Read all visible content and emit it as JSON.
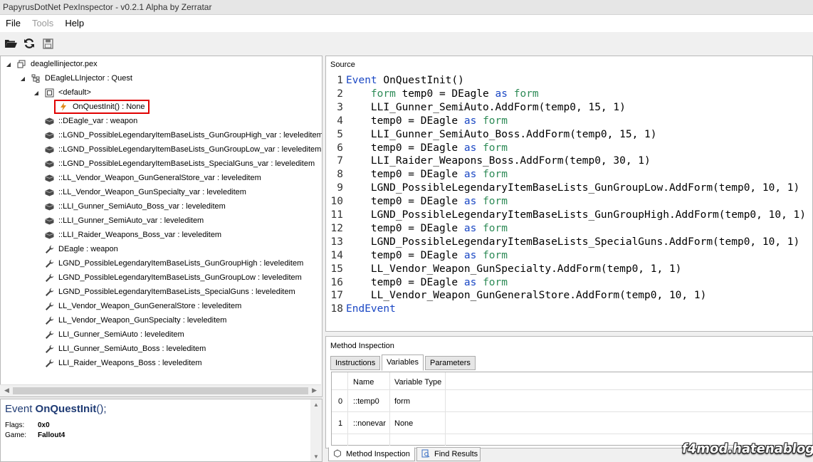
{
  "window": {
    "title": "PapyrusDotNet PexInspector - v0.2.1 Alpha by Zerratar"
  },
  "menu": {
    "file": "File",
    "tools": "Tools",
    "help": "Help"
  },
  "tree": {
    "root": "deaglellinjector.pex",
    "class": "DEagleLLInjector : Quest",
    "state": "<default>",
    "items": [
      {
        "label": "OnQuestInit() : None",
        "icon": "lightning-icon",
        "selected": true
      },
      {
        "label": "::DEagle_var : weapon",
        "icon": "field-icon"
      },
      {
        "label": "::LGND_PossibleLegendaryItemBaseLists_GunGroupHigh_var : leveleditem",
        "icon": "field-icon"
      },
      {
        "label": "::LGND_PossibleLegendaryItemBaseLists_GunGroupLow_var : leveleditem",
        "icon": "field-icon"
      },
      {
        "label": "::LGND_PossibleLegendaryItemBaseLists_SpecialGuns_var : leveleditem",
        "icon": "field-icon"
      },
      {
        "label": "::LL_Vendor_Weapon_GunGeneralStore_var : leveleditem",
        "icon": "field-icon"
      },
      {
        "label": "::LL_Vendor_Weapon_GunSpecialty_var : leveleditem",
        "icon": "field-icon"
      },
      {
        "label": "::LLI_Gunner_SemiAuto_Boss_var : leveleditem",
        "icon": "field-icon"
      },
      {
        "label": "::LLI_Gunner_SemiAuto_var : leveleditem",
        "icon": "field-icon"
      },
      {
        "label": "::LLI_Raider_Weapons_Boss_var : leveleditem",
        "icon": "field-icon"
      },
      {
        "label": "DEagle : weapon",
        "icon": "wrench-icon"
      },
      {
        "label": "LGND_PossibleLegendaryItemBaseLists_GunGroupHigh : leveleditem",
        "icon": "wrench-icon"
      },
      {
        "label": "LGND_PossibleLegendaryItemBaseLists_GunGroupLow : leveleditem",
        "icon": "wrench-icon"
      },
      {
        "label": "LGND_PossibleLegendaryItemBaseLists_SpecialGuns : leveleditem",
        "icon": "wrench-icon"
      },
      {
        "label": "LL_Vendor_Weapon_GunGeneralStore : leveleditem",
        "icon": "wrench-icon"
      },
      {
        "label": "LL_Vendor_Weapon_GunSpecialty : leveleditem",
        "icon": "wrench-icon"
      },
      {
        "label": "LLI_Gunner_SemiAuto : leveleditem",
        "icon": "wrench-icon"
      },
      {
        "label": "LLI_Gunner_SemiAuto_Boss : leveleditem",
        "icon": "wrench-icon"
      },
      {
        "label": "LLI_Raider_Weapons_Boss : leveleditem",
        "icon": "wrench-icon"
      }
    ]
  },
  "details": {
    "sig_prefix": "Event ",
    "sig_name": "OnQuestInit",
    "sig_suffix": "();",
    "flags_label": "Flags:",
    "flags_value": "0x0",
    "game_label": "Game:",
    "game_value": "Fallout4"
  },
  "source": {
    "title": "Source",
    "lines": [
      [
        {
          "t": "Event",
          "c": "kw"
        },
        {
          "t": " OnQuestInit()",
          "c": "cd"
        }
      ],
      [
        {
          "t": "    form",
          "c": "ty"
        },
        {
          "t": " temp0 = DEagle ",
          "c": "cd"
        },
        {
          "t": "as",
          "c": "kw"
        },
        {
          "t": " form",
          "c": "ty"
        }
      ],
      [
        {
          "t": "    LLI_Gunner_SemiAuto.AddForm(temp0, 15, 1)",
          "c": "cd"
        }
      ],
      [
        {
          "t": "    temp0 = DEagle ",
          "c": "cd"
        },
        {
          "t": "as",
          "c": "kw"
        },
        {
          "t": " form",
          "c": "ty"
        }
      ],
      [
        {
          "t": "    LLI_Gunner_SemiAuto_Boss.AddForm(temp0, 15, 1)",
          "c": "cd"
        }
      ],
      [
        {
          "t": "    temp0 = DEagle ",
          "c": "cd"
        },
        {
          "t": "as",
          "c": "kw"
        },
        {
          "t": " form",
          "c": "ty"
        }
      ],
      [
        {
          "t": "    LLI_Raider_Weapons_Boss.AddForm(temp0, 30, 1)",
          "c": "cd"
        }
      ],
      [
        {
          "t": "    temp0 = DEagle ",
          "c": "cd"
        },
        {
          "t": "as",
          "c": "kw"
        },
        {
          "t": " form",
          "c": "ty"
        }
      ],
      [
        {
          "t": "    LGND_PossibleLegendaryItemBaseLists_GunGroupLow.AddForm(temp0, 10, 1)",
          "c": "cd"
        }
      ],
      [
        {
          "t": "    temp0 = DEagle ",
          "c": "cd"
        },
        {
          "t": "as",
          "c": "kw"
        },
        {
          "t": " form",
          "c": "ty"
        }
      ],
      [
        {
          "t": "    LGND_PossibleLegendaryItemBaseLists_GunGroupHigh.AddForm(temp0, 10, 1)",
          "c": "cd"
        }
      ],
      [
        {
          "t": "    temp0 = DEagle ",
          "c": "cd"
        },
        {
          "t": "as",
          "c": "kw"
        },
        {
          "t": " form",
          "c": "ty"
        }
      ],
      [
        {
          "t": "    LGND_PossibleLegendaryItemBaseLists_SpecialGuns.AddForm(temp0, 10, 1)",
          "c": "cd"
        }
      ],
      [
        {
          "t": "    temp0 = DEagle ",
          "c": "cd"
        },
        {
          "t": "as",
          "c": "kw"
        },
        {
          "t": " form",
          "c": "ty"
        }
      ],
      [
        {
          "t": "    LL_Vendor_Weapon_GunSpecialty.AddForm(temp0, 1, 1)",
          "c": "cd"
        }
      ],
      [
        {
          "t": "    temp0 = DEagle ",
          "c": "cd"
        },
        {
          "t": "as",
          "c": "kw"
        },
        {
          "t": " form",
          "c": "ty"
        }
      ],
      [
        {
          "t": "    LL_Vendor_Weapon_GunGeneralStore.AddForm(temp0, 10, 1)",
          "c": "cd"
        }
      ],
      [
        {
          "t": "EndEvent",
          "c": "kw"
        }
      ]
    ]
  },
  "inspection": {
    "title": "Method Inspection",
    "tabs": [
      "Instructions",
      "Variables",
      "Parameters"
    ],
    "active_tab": "Variables",
    "columns": [
      "Name",
      "Variable Type"
    ],
    "rows": [
      {
        "index": "0",
        "name": "::temp0",
        "type": "form"
      },
      {
        "index": "1",
        "name": "::nonevar",
        "type": "None"
      }
    ]
  },
  "bottom_tabs": {
    "method_inspection": "Method Inspection",
    "find_results": "Find Results"
  },
  "colors": {
    "keyword": "#1a47c4",
    "type": "#2e8b57",
    "selection_border": "#e00000"
  }
}
